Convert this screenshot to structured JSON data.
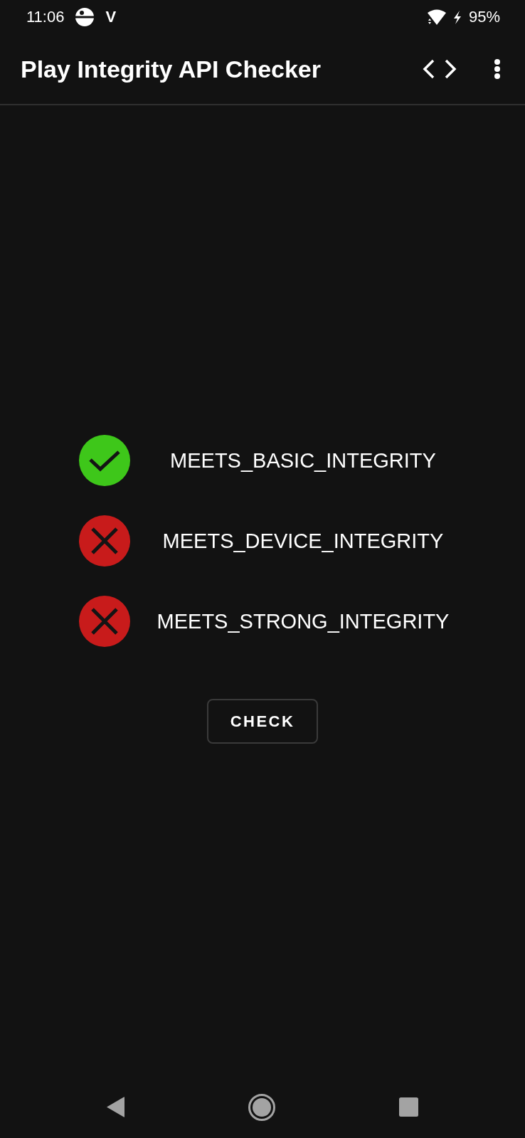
{
  "status_bar": {
    "time": "11:06",
    "notification_letter": "V",
    "charging": true,
    "battery": "95%"
  },
  "app_bar": {
    "title": "Play Integrity API Checker"
  },
  "checks": [
    {
      "label": "MEETS_BASIC_INTEGRITY",
      "passed": true
    },
    {
      "label": "MEETS_DEVICE_INTEGRITY",
      "passed": false
    },
    {
      "label": "MEETS_STRONG_INTEGRITY",
      "passed": false
    }
  ],
  "check_button": {
    "label": "CHECK"
  }
}
